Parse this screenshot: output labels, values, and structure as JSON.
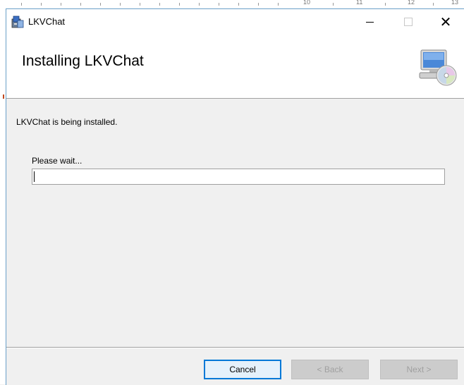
{
  "window": {
    "title": "LKVChat",
    "minimize_label": "Minimize",
    "maximize_label": "Maximize",
    "close_glyph": "✕"
  },
  "banner": {
    "heading": "Installing LKVChat",
    "icon": "computer-cd-icon"
  },
  "main": {
    "status_text": "LKVChat is being installed.",
    "wait_label": "Please wait...",
    "progress": 0
  },
  "buttons": {
    "cancel": "Cancel",
    "back": "< Back",
    "next": "Next >"
  },
  "background": {
    "ruler_numbers": [
      "10",
      "11",
      "12",
      "13"
    ]
  },
  "colors": {
    "accent": "#0078d7",
    "progress_fill": "#06b025"
  }
}
